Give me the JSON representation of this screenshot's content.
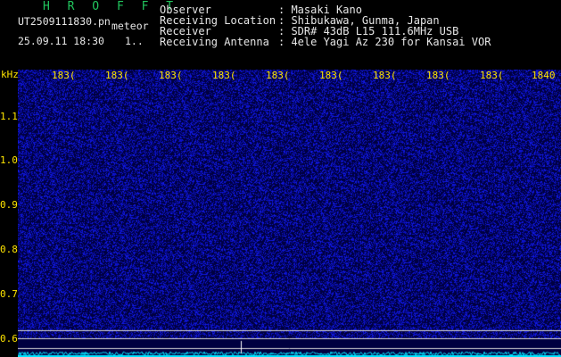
{
  "header": {
    "app_title": "H R O F F T",
    "file_name": "UT2509111830.pn",
    "mode": "meteor",
    "datetime": "25.09.11 18:30",
    "counter": "1..",
    "fields": [
      {
        "label": "Observer",
        "value": ": Masaki Kano"
      },
      {
        "label": "Receiving Location",
        "value": ": Shibukawa, Gunma, Japan"
      },
      {
        "label": "Receiver",
        "value": ": SDR# 43dB L15 111.6MHz USB"
      },
      {
        "label": "Receiving Antenna",
        "value": ": 4ele Yagi Az 230 for Kansai VOR"
      }
    ]
  },
  "spectrogram": {
    "y_unit": "kHz",
    "y_ticks": [
      "1.1",
      "1.0",
      "0.9",
      "0.8",
      "0.7",
      "0.6"
    ],
    "x_ticks": [
      "183(",
      "183(",
      "183(",
      "183(",
      "183(",
      "183(",
      "183(",
      "183(",
      "183(",
      "1840"
    ],
    "colors": {
      "background": "#000040",
      "noise": "#2030c0",
      "text": "#ffe500",
      "trace": "#00e5ff",
      "marker": "#d8d8d8"
    }
  }
}
